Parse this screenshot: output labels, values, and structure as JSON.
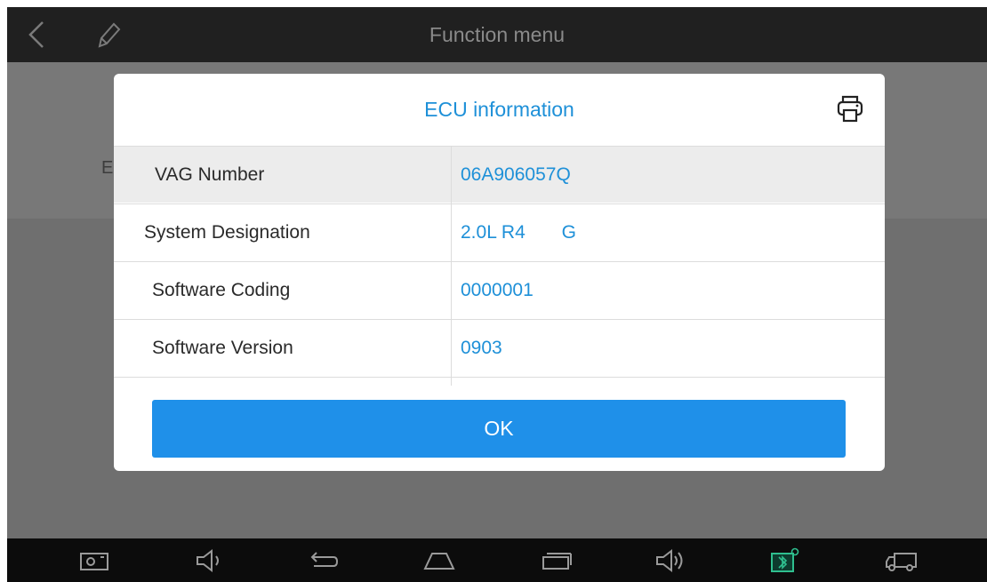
{
  "header": {
    "title": "Function menu",
    "back_icon": "back-arrow-icon",
    "edit_icon": "pencil-icon"
  },
  "background": {
    "partial_label": "E"
  },
  "dialog": {
    "title": "ECU information",
    "print_icon": "printer-icon",
    "rows": [
      {
        "label": "VAG Number",
        "value": "06A906057Q"
      },
      {
        "label": "System Designation",
        "value": "2.0L R4       G"
      },
      {
        "label": "Software Coding",
        "value": "0000001"
      },
      {
        "label": "Software Version",
        "value": "0903"
      }
    ],
    "ok_label": "OK"
  },
  "navbar": {
    "icons": [
      "screenshot-icon",
      "volume-down-icon",
      "back-icon",
      "home-icon",
      "recent-apps-icon",
      "volume-up-icon",
      "vci-bluetooth-icon",
      "truck-icon"
    ]
  },
  "colors": {
    "accent": "#1e90d8",
    "button": "#1f90e9",
    "topbar": "#202020",
    "navbar": "#0c0c0c",
    "overlay": "#6f6f6f"
  }
}
